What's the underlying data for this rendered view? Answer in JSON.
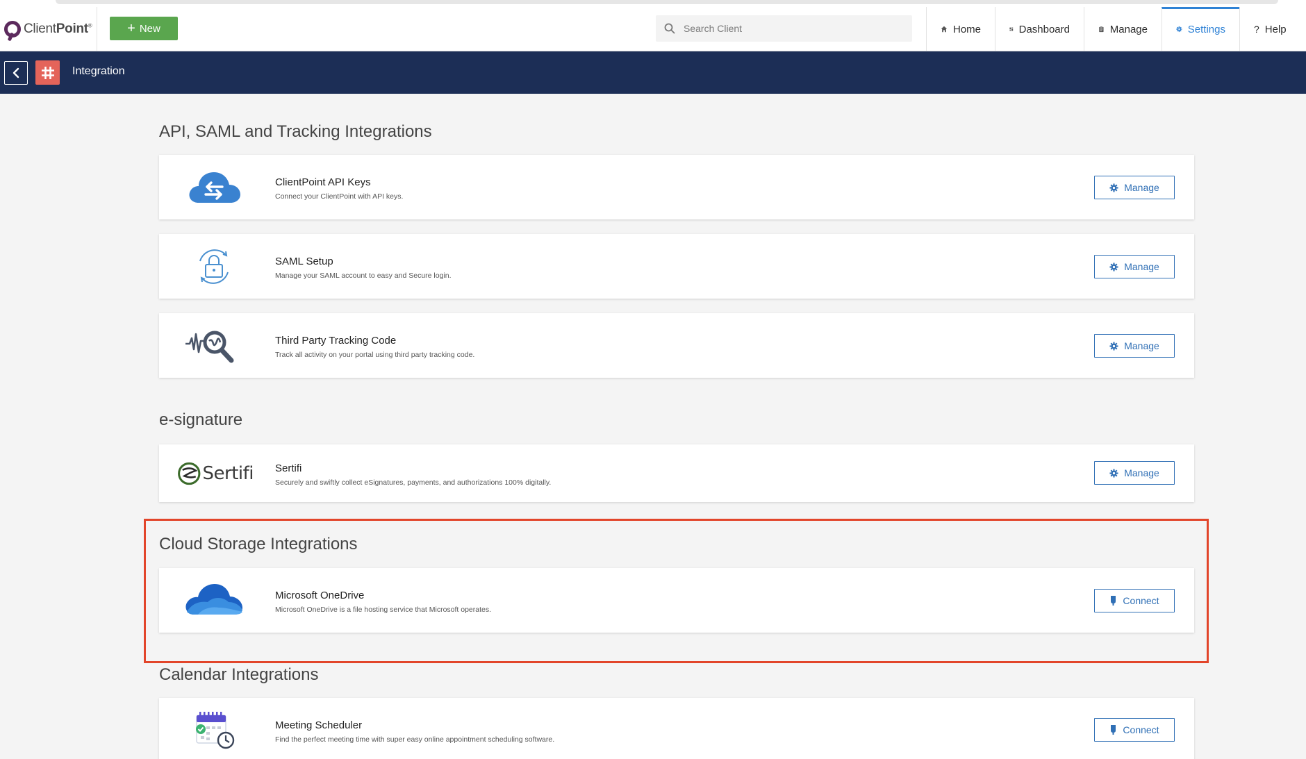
{
  "header": {
    "logo_word_light": "Client",
    "logo_word_bold": "Point",
    "logo_reg": "®",
    "new_button": "New",
    "search_placeholder": "Search Client",
    "nav": [
      {
        "label": "Home",
        "icon": "home-icon"
      },
      {
        "label": "Dashboard",
        "icon": "dashboard-icon"
      },
      {
        "label": "Manage",
        "icon": "clipboard-icon"
      },
      {
        "label": "Settings",
        "icon": "gear-icon",
        "active": true
      },
      {
        "label": "Help",
        "icon": "question-icon"
      }
    ],
    "help_glyph": "?"
  },
  "titlebar": {
    "title": "Integration"
  },
  "sections": {
    "api": {
      "title": "API, SAML and Tracking Integrations",
      "items": [
        {
          "name": "ClientPoint API Keys",
          "desc": "Connect your ClientPoint with API keys.",
          "action": "Manage"
        },
        {
          "name": "SAML Setup",
          "desc": "Manage your SAML account to easy and Secure login.",
          "action": "Manage"
        },
        {
          "name": "Third Party Tracking Code",
          "desc": "Track all activity on your portal using third party tracking code.",
          "action": "Manage"
        }
      ]
    },
    "esign": {
      "title": "e-signature",
      "items": [
        {
          "name": "Sertifi",
          "desc": "Securely and swiftly collect eSignatures, payments, and authorizations 100% digitally.",
          "action": "Manage",
          "logo_text": "Sertifi"
        }
      ]
    },
    "cloud": {
      "title": "Cloud Storage Integrations",
      "items": [
        {
          "name": "Microsoft OneDrive",
          "desc": "Microsoft OneDrive is a file hosting service that Microsoft operates.",
          "action": "Connect"
        }
      ]
    },
    "calendar": {
      "title": "Calendar Integrations",
      "items": [
        {
          "name": "Meeting Scheduler",
          "desc": "Find the perfect meeting time with super easy online appointment scheduling software.",
          "action": "Connect"
        }
      ]
    }
  },
  "colors": {
    "navy": "#1c2e56",
    "green": "#5aa64e",
    "accent_blue": "#2f82d5",
    "highlight_red": "#e2452a"
  }
}
